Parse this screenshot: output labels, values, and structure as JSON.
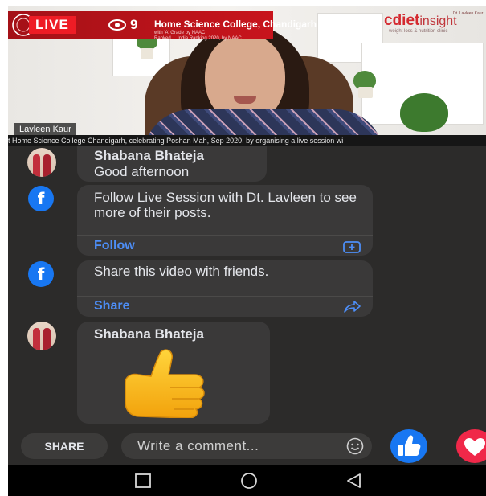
{
  "video": {
    "live_badge": "LIVE",
    "viewer_count": "9",
    "college_name": "Home Science College, Chandigarh",
    "college_subline_1": "with 'A' Grade by NAAC",
    "college_subline_2": "Ranked ... India Ranking 2020, by NAAC",
    "presenter_name": "Lavleen Kaur",
    "ticker": "t Home Science College Chandigarh, celebrating Poshan Mah, Sep 2020, by organising a live session wi",
    "sponsor": {
      "brand_prefix": "c",
      "brand_main": "diet",
      "brand_suffix": "insight",
      "tagline": "weight loss & nutrition clinic",
      "small_text": "Dt. Lavleen Kaur"
    }
  },
  "chat": [
    {
      "type": "comment",
      "author": "Shabana Bhateja",
      "text": "Good afternoon"
    },
    {
      "type": "prompt",
      "text": "Follow Live Session with Dt. Lavleen to see more of their posts.",
      "action": "Follow",
      "icon": "follow-icon"
    },
    {
      "type": "prompt",
      "text": "Share this video with friends.",
      "action": "Share",
      "icon": "share-arrow-icon"
    },
    {
      "type": "comment",
      "author": "Shabana Bhateja",
      "sticker": "thumbs-up"
    }
  ],
  "bottom_bar": {
    "share_label": "SHARE",
    "comment_placeholder": "Write a comment...",
    "like_icon": "thumbs-up-icon",
    "love_icon": "heart-icon"
  },
  "nav": {
    "buttons": [
      "recents",
      "home",
      "back"
    ]
  },
  "colors": {
    "live_red": "#ee1c25",
    "facebook_blue": "#1877f2",
    "link_blue": "#4d8ef7",
    "bubble": "#3a3939",
    "background": "#2c2b2a"
  }
}
